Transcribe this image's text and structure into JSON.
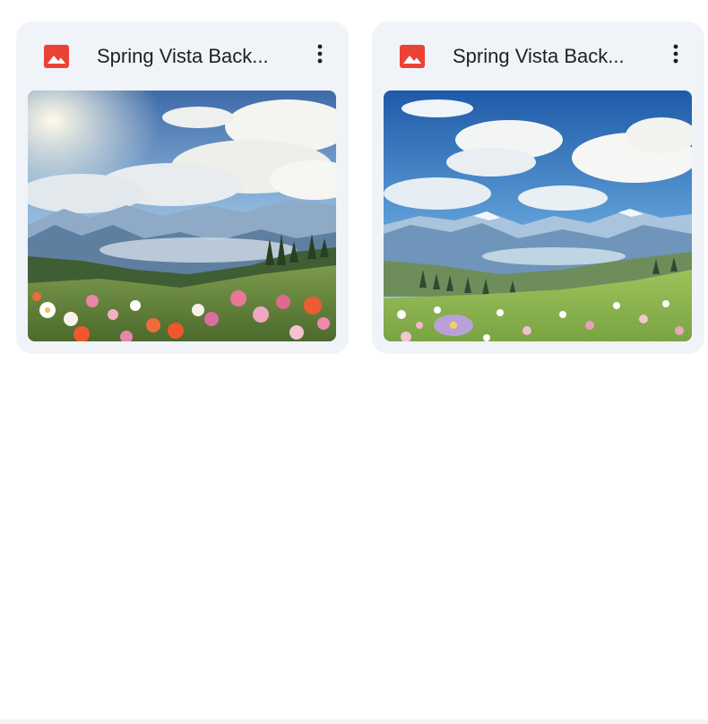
{
  "files": [
    {
      "title": "Spring Vista Back...",
      "type_icon": "image-file-icon",
      "menu_icon": "more-vert-icon"
    },
    {
      "title": "Spring Vista Back...",
      "type_icon": "image-file-icon",
      "menu_icon": "more-vert-icon"
    }
  ],
  "colors": {
    "card_background": "#f0f4f9",
    "image_icon": "#ea4335",
    "title_text": "#1f1f1f",
    "menu_icon": "#1f1f1f"
  }
}
